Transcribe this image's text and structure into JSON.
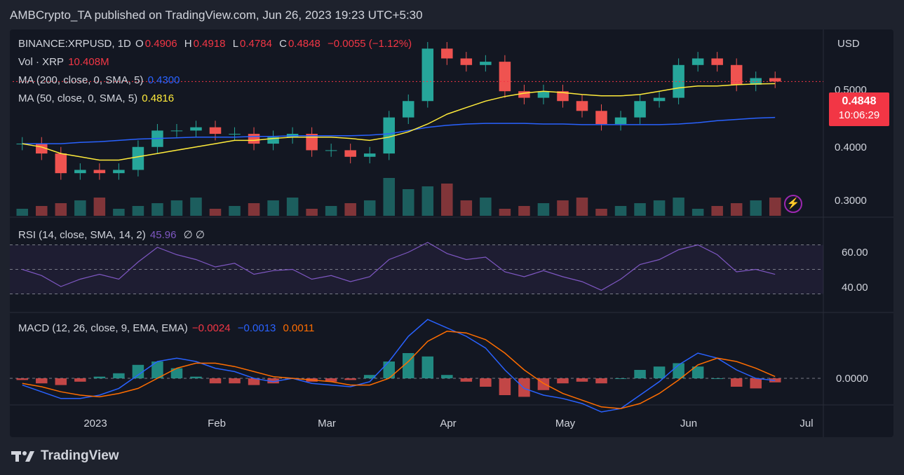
{
  "header": {
    "published_text": "AMBCrypto_TA published on TradingView.com, Jun 26, 2023 19:23 UTC+5:30"
  },
  "brand": {
    "logo_text": "TradingView"
  },
  "legend": {
    "symbol": "BINANCE:XRPUSD, 1D",
    "ohlc": {
      "o_label": "O",
      "o": "0.4906",
      "h_label": "H",
      "h": "0.4918",
      "l_label": "L",
      "l": "0.4784",
      "c_label": "C",
      "c": "0.4848",
      "chg": "−0.0055 (−1.12%)"
    },
    "vol_label": "Vol · XRP",
    "vol_value": "10.408M",
    "ma200_label": "MA (200, close, 0, SMA, 5)",
    "ma200_value": "0.4300",
    "ma50_label": "MA (50, close, 0, SMA, 5)",
    "ma50_value": "0.4816",
    "rsi_label": "RSI (14, close, SMA, 14, 2)",
    "rsi_value": "45.96",
    "rsi_extra": "∅ ∅",
    "macd_label": "MACD (12, 26, close, 9, EMA, EMA)",
    "macd_hist": "−0.0024",
    "macd_line": "−0.0013",
    "macd_signal": "0.0011"
  },
  "price_axis": {
    "currency": "USD",
    "ticks": [
      "0.5000",
      "0.4000",
      "0.3000"
    ],
    "last_price": "0.4848",
    "countdown": "10:06:29"
  },
  "rsi_axis": {
    "ticks": [
      "60.00",
      "40.00"
    ]
  },
  "macd_axis": {
    "ticks": [
      "0.0000"
    ]
  },
  "time_axis": {
    "labels": [
      "2023",
      "Feb",
      "Mar",
      "Apr",
      "May",
      "Jun",
      "Jul"
    ]
  },
  "colors": {
    "up": "#26a69a",
    "down": "#ef5350",
    "ma200": "#2962ff",
    "ma50": "#ffeb3b",
    "rsi": "#7e57c2",
    "macd": "#2962ff",
    "signal": "#ff6d00"
  },
  "chart_data": {
    "type": "candlestick",
    "title": "BINANCE:XRPUSD, 1D",
    "ylim": [
      0.28,
      0.56
    ],
    "x": [
      "2022-12-12",
      "2022-12-17",
      "2022-12-22",
      "2022-12-27",
      "2023-01-01",
      "2023-01-06",
      "2023-01-11",
      "2023-01-16",
      "2023-01-21",
      "2023-01-26",
      "2023-01-31",
      "2023-02-05",
      "2023-02-10",
      "2023-02-15",
      "2023-02-20",
      "2023-02-25",
      "2023-03-02",
      "2023-03-07",
      "2023-03-12",
      "2023-03-17",
      "2023-03-22",
      "2023-03-27",
      "2023-04-01",
      "2023-04-06",
      "2023-04-11",
      "2023-04-16",
      "2023-04-21",
      "2023-04-26",
      "2023-05-01",
      "2023-05-06",
      "2023-05-11",
      "2023-05-16",
      "2023-05-21",
      "2023-05-26",
      "2023-05-31",
      "2023-06-05",
      "2023-06-10",
      "2023-06-15",
      "2023-06-20",
      "2023-06-25"
    ],
    "close": [
      0.39,
      0.375,
      0.345,
      0.35,
      0.345,
      0.35,
      0.385,
      0.41,
      0.41,
      0.415,
      0.405,
      0.405,
      0.39,
      0.4,
      0.405,
      0.38,
      0.38,
      0.37,
      0.375,
      0.43,
      0.455,
      0.535,
      0.52,
      0.51,
      0.515,
      0.47,
      0.46,
      0.47,
      0.455,
      0.44,
      0.42,
      0.43,
      0.455,
      0.46,
      0.51,
      0.52,
      0.51,
      0.48,
      0.49,
      0.4848
    ],
    "ma50": [
      0.39,
      0.385,
      0.375,
      0.37,
      0.365,
      0.365,
      0.37,
      0.375,
      0.38,
      0.385,
      0.39,
      0.395,
      0.395,
      0.398,
      0.4,
      0.4,
      0.4,
      0.398,
      0.395,
      0.4,
      0.408,
      0.42,
      0.435,
      0.445,
      0.455,
      0.462,
      0.467,
      0.47,
      0.468,
      0.465,
      0.463,
      0.463,
      0.465,
      0.47,
      0.475,
      0.478,
      0.478,
      0.48,
      0.481,
      0.4816
    ],
    "ma200": [
      0.39,
      0.39,
      0.39,
      0.392,
      0.393,
      0.395,
      0.397,
      0.398,
      0.399,
      0.4,
      0.4,
      0.4,
      0.401,
      0.401,
      0.402,
      0.402,
      0.402,
      0.402,
      0.403,
      0.405,
      0.41,
      0.415,
      0.418,
      0.42,
      0.421,
      0.421,
      0.421,
      0.42,
      0.42,
      0.419,
      0.419,
      0.419,
      0.419,
      0.419,
      0.42,
      0.422,
      0.425,
      0.427,
      0.429,
      0.43
    ],
    "rsi": [
      50,
      45,
      36,
      42,
      46,
      42,
      56,
      68,
      62,
      58,
      52,
      55,
      46,
      49,
      50,
      42,
      45,
      40,
      44,
      58,
      64,
      72,
      63,
      58,
      60,
      48,
      44,
      49,
      44,
      40,
      33,
      42,
      54,
      58,
      66,
      70,
      62,
      48,
      50,
      45.96
    ],
    "macd": [
      -0.004,
      -0.008,
      -0.012,
      -0.012,
      -0.01,
      -0.006,
      0.002,
      0.01,
      0.012,
      0.01,
      0.006,
      0.004,
      0.0,
      -0.002,
      0.0,
      -0.003,
      -0.004,
      -0.005,
      -0.002,
      0.01,
      0.025,
      0.035,
      0.03,
      0.025,
      0.018,
      0.005,
      -0.006,
      -0.01,
      -0.012,
      -0.015,
      -0.02,
      -0.018,
      -0.01,
      -0.002,
      0.008,
      0.015,
      0.012,
      0.005,
      0.0,
      -0.0013
    ],
    "signal": [
      -0.003,
      -0.005,
      -0.008,
      -0.01,
      -0.011,
      -0.009,
      -0.006,
      0.0,
      0.006,
      0.009,
      0.009,
      0.007,
      0.004,
      0.001,
      0.0,
      -0.001,
      -0.002,
      -0.004,
      -0.004,
      0.0,
      0.01,
      0.022,
      0.028,
      0.027,
      0.023,
      0.015,
      0.005,
      -0.003,
      -0.009,
      -0.013,
      -0.017,
      -0.018,
      -0.015,
      -0.009,
      -0.001,
      0.008,
      0.012,
      0.01,
      0.006,
      0.0011
    ]
  }
}
